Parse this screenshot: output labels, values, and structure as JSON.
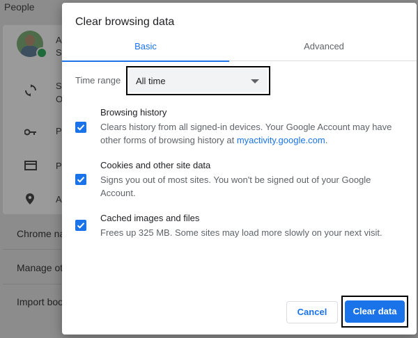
{
  "background": {
    "section_title": "People",
    "account_letter": "A",
    "account_sub_letter": "S",
    "sync_letter": "S",
    "sync_sub_letter": "O",
    "passwords_letter": "P",
    "payments_letter": "P",
    "addresses_letter": "A",
    "row_chrome_name": "Chrome na",
    "row_manage": "Manage oth",
    "row_import": "Import boo"
  },
  "dialog": {
    "title": "Clear browsing data",
    "tabs": [
      {
        "label": "Basic",
        "active": true
      },
      {
        "label": "Advanced",
        "active": false
      }
    ],
    "time_range": {
      "label": "Time range",
      "value": "All time"
    },
    "items": [
      {
        "title": "Browsing history",
        "desc_before": "Clears history from all signed-in devices. Your Google Account may have other forms of browsing history at ",
        "desc_link": "myactivity.google.com",
        "desc_after": ".",
        "checked": true
      },
      {
        "title": "Cookies and other site data",
        "desc": "Signs you out of most sites. You won't be signed out of your Google Account.",
        "checked": true
      },
      {
        "title": "Cached images and files",
        "desc": "Frees up 325 MB. Some sites may load more slowly on your next visit.",
        "checked": true
      }
    ],
    "cancel_label": "Cancel",
    "clear_label": "Clear data"
  },
  "colors": {
    "accent": "#1a73e8",
    "text_primary": "#202124",
    "text_secondary": "#5f6368"
  }
}
